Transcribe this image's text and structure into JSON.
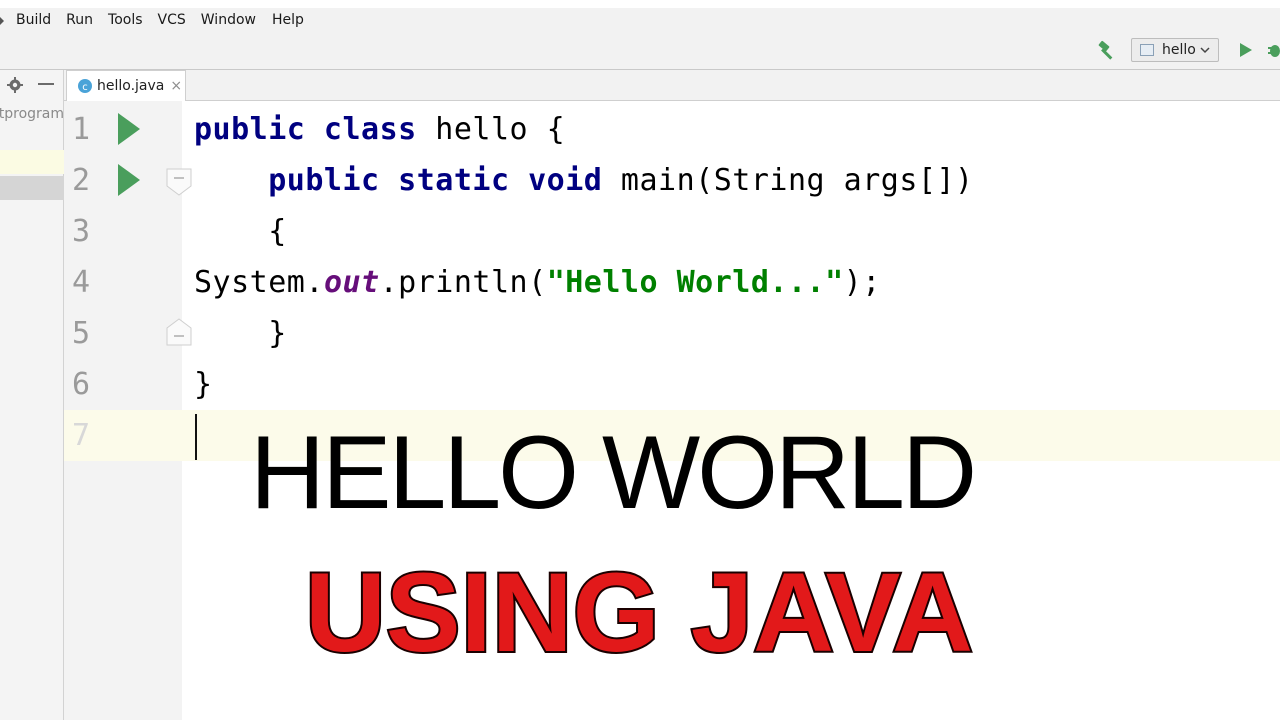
{
  "menu": {
    "items": [
      "Build",
      "Run",
      "Tools",
      "VCS",
      "Window",
      "Help"
    ]
  },
  "toolbar": {
    "run_config_label": "hello",
    "icons": [
      "hammer-icon",
      "run-icon",
      "debug-icon"
    ]
  },
  "sidebar": {
    "project_text": "tprogram"
  },
  "tabs": [
    {
      "label": "hello.java",
      "close": "×"
    }
  ],
  "editor": {
    "line_numbers": [
      "1",
      "2",
      "3",
      "4",
      "5",
      "6",
      "7"
    ],
    "lines": [
      {
        "kw1": "public class",
        "rest": " hello {"
      },
      {
        "indent": "    ",
        "kw1": "public static void",
        "rest": " main(String args[])"
      },
      {
        "text": "    {"
      },
      {
        "pre": "System.",
        "field": "out",
        "mid": ".println(",
        "str": "\"Hello World...\"",
        "post": ");"
      },
      {
        "text": "    }"
      },
      {
        "text": "}"
      },
      {
        "text": ""
      }
    ]
  },
  "overlay": {
    "line1": "HELLO WORLD",
    "line2": "USING  JAVA"
  },
  "colors": {
    "keyword": "#000080",
    "string": "#008000",
    "field": "#660e7a",
    "overlay_red": "#e2191a",
    "run_green": "#4a9e5c"
  }
}
